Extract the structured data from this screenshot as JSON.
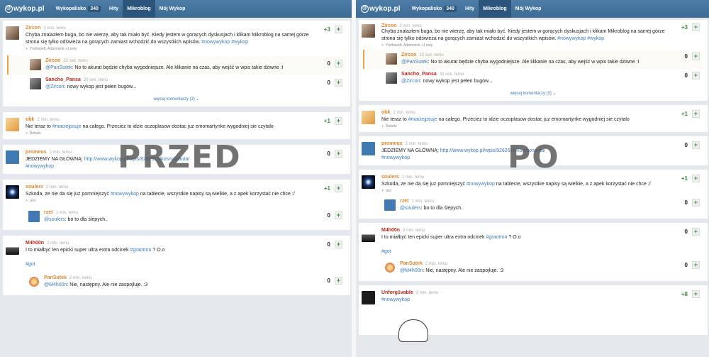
{
  "nav": {
    "logo": "wykop.pl",
    "wykopalisko": "Wykopalisko",
    "wykopalisko_count": "340",
    "hity": "Hity",
    "mikroblog": "Mikroblog",
    "moj_wykop": "Mój Wykop"
  },
  "labels": {
    "przed": "PRZED",
    "po": "PO"
  },
  "posts": {
    "zircon": {
      "author": "Zircon",
      "time": "2 min. temu",
      "text": "Chyba znalazłem buga, bo nie wierzę, aby tak miało być. Kiedy jestem w gorących dyskusjach i klikam Mikroblog na samej górze strona się tylko odświeża na gorących zamiast wchodzić do wszystkich wpisów.",
      "tag1": "#nowywykop",
      "tag2": "#wykop",
      "voters": "+: Yrothspeft, Adammink +1 inny",
      "score": "+3",
      "more": "więcej komentarzy (3)"
    },
    "zircon_c1": {
      "author": "Zircon",
      "time": "22 sek. temu",
      "mention": "@PanSutek",
      "text": ": No to akurat będzie chyba wygodniejsze. Ale klikanie na czas, aby wejść w wpis takie dziwne :I",
      "score": "0"
    },
    "zircon_c2": {
      "author": "Sancho_Pansa",
      "time_left": "20 sek. temu",
      "time_right": "33 sek. temu",
      "mention": "@Zircon",
      "text": ": nowy wykop jest pełen bugów...",
      "score": "0"
    },
    "obk": {
      "author": "obk",
      "time": "2 min. temu",
      "pre": "Nie teraz to",
      "tag": "#maciejpsuje",
      "text": "na całego. Przeciez to idzie oczoplasow dostac juz emomartynke wygodniej sie czytalo",
      "voters": "+: Robalo",
      "score": "+1"
    },
    "promeus": {
      "author": "promeus",
      "time": "2 min. temu",
      "pre": "JEDZIEMY NA GŁÓWNĄ:",
      "link": "http://www.wykop.pl/wpis/8262616/kosmonauta/",
      "tag": "#nowywykop",
      "score": "0"
    },
    "soulers": {
      "author": "soulers",
      "time": "2 min. temu",
      "pre": "Szkoda, ze nie da się juz pomniejszyć",
      "tag": "#nowywykop",
      "text": "na tablecie, wszystkie napisy są wielkie, a z apek korzystać nie chce :/",
      "voters": "+: rzet",
      "score": "+1"
    },
    "soulers_c1": {
      "author": "rzet",
      "time": "1 min. temu",
      "mention": "@soulers",
      "text": ": bo to dla ślepych..",
      "score": "0"
    },
    "m4h0on": {
      "author": "M4h00n",
      "time": "2 min. temu",
      "pre": "I to miałbyć ten epicki super ultra extra odcinek",
      "tag": "#graotron",
      "text": "? O.o",
      "tag2": "#got",
      "score": "0"
    },
    "m4h0on_c1": {
      "author": "PanSutek",
      "time": "2 min. temu",
      "mention": "@M4h00n",
      "text": ": Nie, następny. Ale nie zaspojluje. :3",
      "score": "0"
    },
    "unforg": {
      "author": "Unforg1vable",
      "time": "2 min. temu",
      "tag": "#nowywykop",
      "score": "+8"
    }
  },
  "colors": {
    "nav": "#3b6a93",
    "tag": "#3a7bb8",
    "author_orange": "#e08630",
    "author_red": "#b5281c",
    "plus_green": "#3d8a3d"
  }
}
